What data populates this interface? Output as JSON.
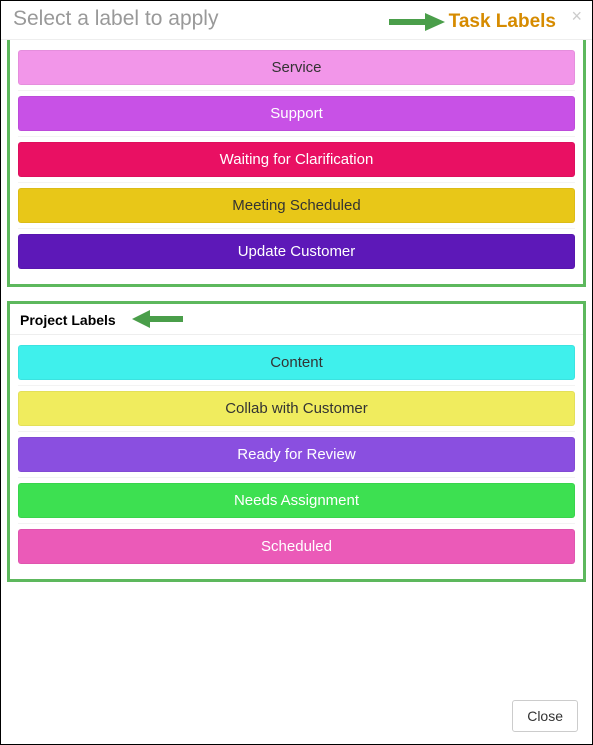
{
  "header": {
    "title": "Select a label to apply",
    "close_x": "×"
  },
  "annotations": {
    "task_labels": "Task Labels",
    "project_labels": "Project Labels"
  },
  "task_labels": [
    {
      "label": "Service",
      "bg": "#f296e9",
      "fg": "#333333"
    },
    {
      "label": "Support",
      "bg": "#c851e6",
      "fg": "#ffffff"
    },
    {
      "label": "Waiting for Clarification",
      "bg": "#e91063",
      "fg": "#ffffff"
    },
    {
      "label": "Meeting Scheduled",
      "bg": "#e8c718",
      "fg": "#333333"
    },
    {
      "label": "Update Customer",
      "bg": "#5d18b8",
      "fg": "#ffffff"
    }
  ],
  "project_labels_header": "Project Labels",
  "project_labels": [
    {
      "label": "Content",
      "bg": "#3ff0ec",
      "fg": "#333333"
    },
    {
      "label": "Collab with Customer",
      "bg": "#f0ec5e",
      "fg": "#333333"
    },
    {
      "label": "Ready for Review",
      "bg": "#8a4fe0",
      "fg": "#ffffff"
    },
    {
      "label": "Needs Assignment",
      "bg": "#3de051",
      "fg": "#ffffff"
    },
    {
      "label": "Scheduled",
      "bg": "#eb5ab8",
      "fg": "#ffffff"
    }
  ],
  "footer": {
    "close": "Close"
  }
}
